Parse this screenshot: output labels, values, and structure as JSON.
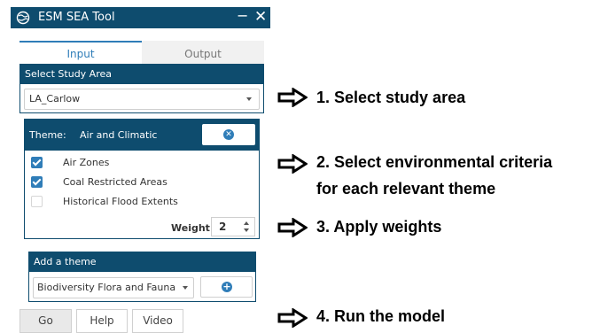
{
  "window": {
    "title": "ESM SEA Tool",
    "minimize": "−",
    "close": "✕"
  },
  "tabs": [
    {
      "label": "Input"
    },
    {
      "label": "Output"
    }
  ],
  "study_area": {
    "header": "Select Study Area",
    "selected": "LA_Carlow"
  },
  "theme": {
    "label": "Theme:",
    "value": "Air and Climatic",
    "criteria": [
      {
        "label": "Air Zones",
        "checked": true
      },
      {
        "label": "Coal Restricted Areas",
        "checked": true
      },
      {
        "label": "Historical Flood Extents",
        "checked": false
      }
    ],
    "weight_label": "Weight:",
    "weight_value": "2"
  },
  "add_theme": {
    "header": "Add a theme",
    "selected": "Biodiversity Flora and Fauna"
  },
  "buttons": {
    "go": "Go",
    "help": "Help",
    "video": "Video"
  },
  "annotations": [
    "1. Select study area",
    "2. Select environmental criteria",
    "for each relevant theme",
    "3. Apply weights",
    "4. Run the model"
  ],
  "colors": {
    "header": "#0e4c6e",
    "accent": "#2f7db8"
  },
  "icons": {
    "logo": "globe-icon",
    "clear": "clear-circle-icon",
    "add": "plus-circle-icon",
    "arrow": "right-arrow-icon"
  }
}
